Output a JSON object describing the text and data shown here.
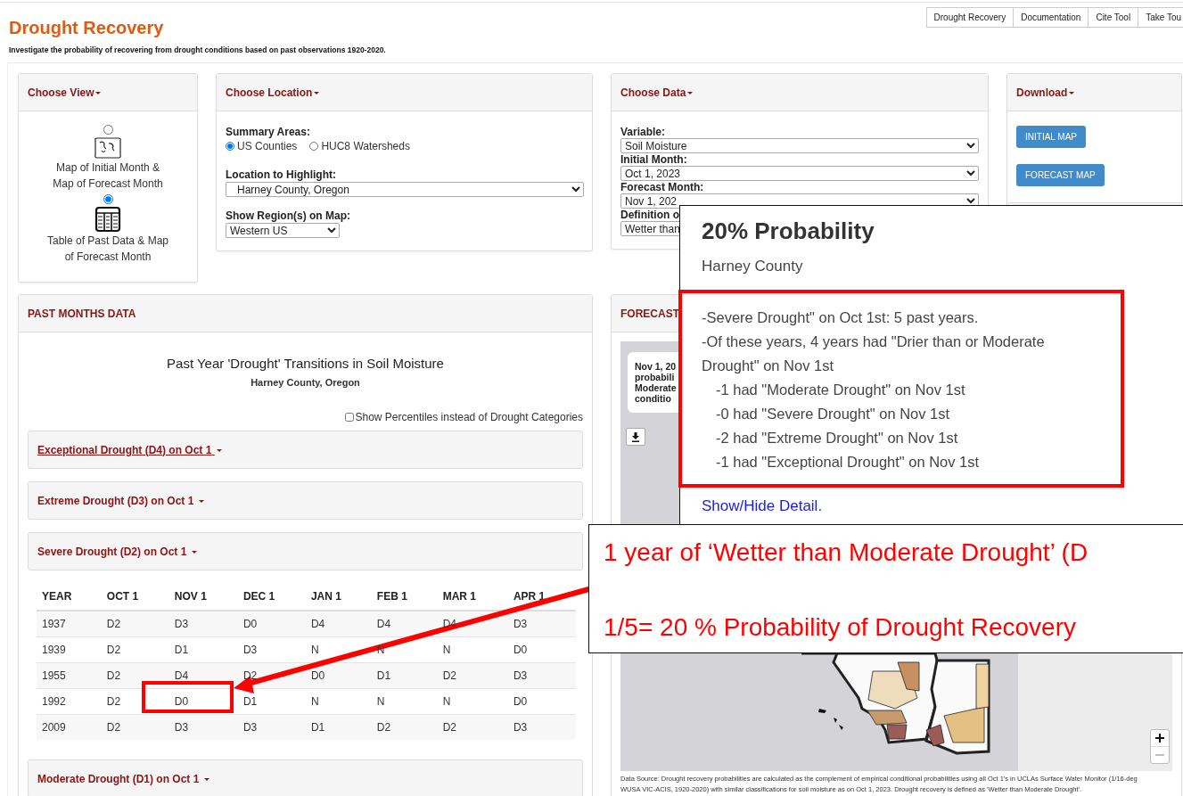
{
  "header": {
    "title": "Drought Recovery",
    "subtitle": "Investigate the probability of recovering from drought conditions based on past observations 1920-2020."
  },
  "nav_buttons": [
    "Drought Recovery",
    "Documentation",
    "Cite Tool",
    "Take Tou"
  ],
  "choose_view": {
    "title": "Choose View",
    "options": [
      {
        "kind": "map",
        "label": "Map of Initial Month & Map of Forecast Month",
        "selected": false
      },
      {
        "kind": "table",
        "label": "Table of Past Data & Map of Forecast Month",
        "selected": true
      }
    ]
  },
  "choose_location": {
    "title": "Choose Location",
    "summary_label": "Summary Areas:",
    "summary_options": [
      {
        "label": "US Counties",
        "selected": true
      },
      {
        "label": "HUC8 Watersheds",
        "selected": false
      }
    ],
    "highlight_label": "Location to Highlight:",
    "highlight_value": "Harney County, Oregon",
    "region_label": "Show Region(s) on Map:",
    "region_value": "Western US"
  },
  "choose_data": {
    "title": "Choose Data",
    "fields": [
      {
        "label": "Variable:",
        "value": "Soil Moisture"
      },
      {
        "label": "Initial Month:",
        "value": "Oct 1, 2023"
      },
      {
        "label": "Forecast Month:",
        "value": "Nov 1, 202"
      },
      {
        "label": "Definition o",
        "value": "Wetter than"
      }
    ]
  },
  "download": {
    "title": "Download",
    "buttons": [
      "INITIAL MAP",
      "FORECAST MAP"
    ]
  },
  "past_months": {
    "title": "PAST MONTHS DATA",
    "chart_title": "Past Year 'Drought' Transitions in Soil Moisture",
    "location": "Harney County, Oregon",
    "percentile_toggle": {
      "label": "Show Percentiles instead of Drought Categories",
      "checked": false
    },
    "sections": [
      {
        "label": "Exceptional Drought (D4) on Oct 1",
        "hovered": true
      },
      {
        "label": "Extreme Drought (D3) on Oct 1",
        "hovered": false
      },
      {
        "label": "Severe Drought (D2) on Oct 1",
        "hovered": false,
        "table": {
          "columns": [
            "YEAR",
            "OCT 1",
            "NOV 1",
            "DEC 1",
            "JAN 1",
            "FEB 1",
            "MAR 1",
            "APR 1"
          ],
          "rows": [
            [
              "1937",
              "D2",
              "D3",
              "D0",
              "D4",
              "D4",
              "D4",
              "D3"
            ],
            [
              "1939",
              "D2",
              "D1",
              "D3",
              "N",
              "N",
              "N",
              "D0"
            ],
            [
              "1955",
              "D2",
              "D4",
              "D2",
              "D0",
              "D1",
              "D2",
              "D3"
            ],
            [
              "1992",
              "D2",
              "D0",
              "D1",
              "N",
              "N",
              "N",
              "D0"
            ],
            [
              "2009",
              "D2",
              "D3",
              "D3",
              "D1",
              "D2",
              "D2",
              "D3"
            ]
          ]
        }
      },
      {
        "label": "Moderate Drought (D1) on Oct 1",
        "hovered": false
      }
    ]
  },
  "forecast": {
    "title": "FORECAST",
    "card_lines": [
      "Nov 1, 20",
      "probabili",
      "Moderate",
      "conditio"
    ],
    "footer": "Data Source: Drought recovery probabilities are calculated as the complement of empirical conditional probabilities using all Oct 1's in UCLAs Surface Water Monitor (1/16-deg WUSA VIC-ACIS, 1920-2020) with similar classifications for soil moisture as on Oct 1, 2023. Drought recovery is defined as 'Wetter than Moderate Drought'."
  },
  "popup": {
    "title": "20% Probability",
    "subtitle": "Harney County",
    "detail_lines": [
      {
        "kind": "main",
        "text": "-Severe Drought\" on Oct 1st: 5 past years."
      },
      {
        "kind": "main",
        "text": "-Of these years, 4 years had \"Drier than or Moderate Drought\" on Nov 1st"
      },
      {
        "kind": "sub",
        "text": "-1 had \"Moderate Drought\" on Nov 1st"
      },
      {
        "kind": "sub",
        "text": "-0 had \"Severe Drought\" on Nov 1st"
      },
      {
        "kind": "sub",
        "text": "-2 had \"Extreme Drought\" on Nov 1st"
      },
      {
        "kind": "sub",
        "text": "-1 had \"Exceptional Drought\" on Nov 1st"
      }
    ],
    "link": "Show/Hide Detail."
  },
  "annotation": {
    "lines": [
      "1 year of ‘Wetter than Moderate Drought’ (D",
      "1/5= 20 % Probability of Drought Recovery"
    ]
  }
}
